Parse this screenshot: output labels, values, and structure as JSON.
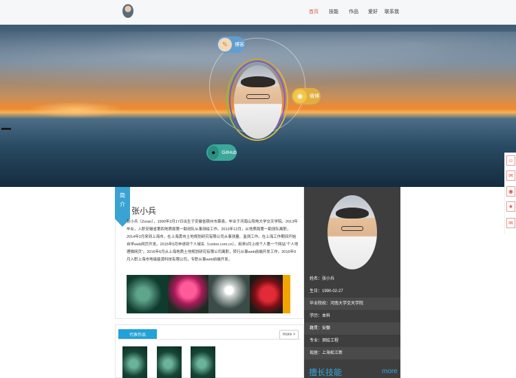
{
  "nav": {
    "links": [
      "首页",
      "技能",
      "作品",
      "爱好",
      "联系我"
    ]
  },
  "banner": {
    "blog_label": "博客",
    "weibo_label": "微博",
    "github_label": "GitHub"
  },
  "sidebar_tools": [
    "QQ",
    "微信",
    "微博",
    "空间",
    "邮件"
  ],
  "profile": {
    "tab_label_1": "简",
    "tab_label_2": "介",
    "name": "张小兵",
    "bio": "张小兵（Zoran），1990年2月17日出生于安徽省宿州市萧县。毕业于河南山阳地大学交天学院。2013年毕业，入职安徽省第四地质局第一勘测队从事测绘工作。2013年12月，从地质局第一勘测队离职，2014年2月来到上海市，在上海勇市土地规划研究有限公司从事测量、监测工作。在上海工作期间开始自学web网页开发。2015年5月申请到个人域名（runton.com.cn），用来9月上线个人第一个网站“个人地理微网页”。2016年6月从上海地质土地规划研究有限公司离职，转行从事web前端开发工作。2016年9月入职上海市地级能源科技有限公司，专职从事web前端开发。"
  },
  "info": {
    "rows": [
      "姓名：张小兵",
      "生日：1990-02-27",
      "毕业院校：河南大学交天学院",
      "学历：本科",
      "籍贯：安徽",
      "专业：测绘工程",
      "现居：上海松江新"
    ],
    "skills_title": "擅长技能",
    "skills_more": "more"
  },
  "works": {
    "title": "代表作品",
    "more": "more >"
  },
  "colors": {
    "accent_blue": "#22a2d6",
    "nav_active": "#d9534f",
    "info_panel": "#3e3e3e"
  }
}
